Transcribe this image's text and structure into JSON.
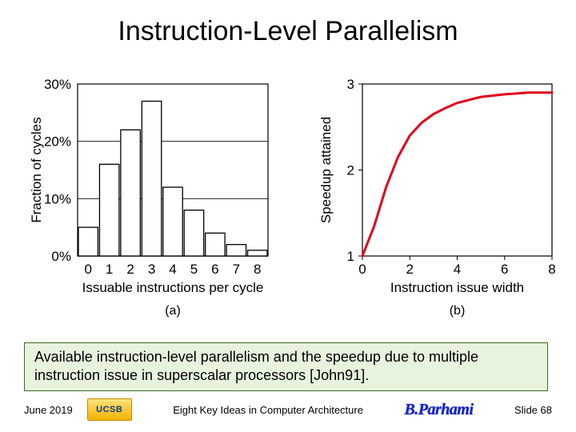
{
  "title": "Instruction-Level Parallelism",
  "chart_data": [
    {
      "type": "bar",
      "title": "",
      "xlabel": "Issuable instructions per cycle",
      "ylabel": "Fraction of cycles",
      "categories": [
        "0",
        "1",
        "2",
        "3",
        "4",
        "5",
        "6",
        "7",
        "8"
      ],
      "values": [
        5,
        16,
        22,
        27,
        12,
        8,
        4,
        2,
        1
      ],
      "ylim": [
        0,
        30
      ],
      "yticks": [
        "0%",
        "10%",
        "20%",
        "30%"
      ],
      "xticks": [
        "0",
        "1",
        "2",
        "3",
        "4",
        "5",
        "6",
        "7",
        "8"
      ],
      "subplot_label": "(a)"
    },
    {
      "type": "line",
      "title": "",
      "xlabel": "Instruction issue width",
      "ylabel": "Speedup attained",
      "series": [
        {
          "name": "speedup",
          "color": "#e2001a",
          "x": [
            0,
            0.5,
            1,
            1.5,
            2,
            2.5,
            3,
            3.5,
            4,
            5,
            6,
            7,
            8
          ],
          "y": [
            1.0,
            1.35,
            1.8,
            2.15,
            2.4,
            2.55,
            2.65,
            2.72,
            2.78,
            2.85,
            2.88,
            2.9,
            2.9
          ]
        }
      ],
      "ylim": [
        1,
        3
      ],
      "xlim": [
        0,
        8
      ],
      "yticks": [
        "1",
        "2",
        "3"
      ],
      "xticks": [
        "0",
        "2",
        "4",
        "6",
        "8"
      ],
      "subplot_label": "(b)"
    }
  ],
  "caption": "Available instruction-level parallelism and the speedup due to multiple instruction issue in superscalar processors [John91].",
  "footer": {
    "date": "June 2019",
    "logo_text": "UCSB",
    "center": "Eight Key Ideas in Computer Architecture",
    "author": "B.Parhami",
    "slide": "Slide 68"
  }
}
